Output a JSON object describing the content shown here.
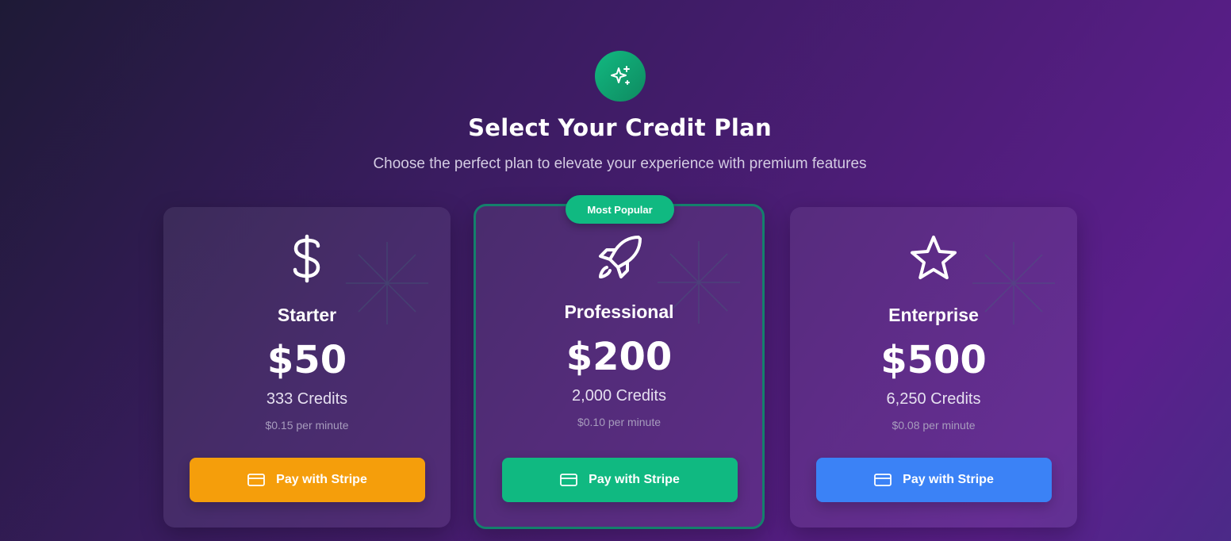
{
  "header": {
    "logo_icon": "sparkles-icon",
    "title": "Select Your Credit Plan",
    "subtitle": "Choose the perfect plan to elevate your experience with premium features"
  },
  "plans": [
    {
      "icon": "dollar-icon",
      "name": "Starter",
      "price": "$50",
      "credits": "333 Credits",
      "rate": "$0.15 per minute",
      "button_label": "Pay with Stripe",
      "button_color": "#f59e0b"
    },
    {
      "icon": "rocket-icon",
      "badge": "Most Popular",
      "name": "Professional",
      "price": "$200",
      "credits": "2,000 Credits",
      "rate": "$0.10 per minute",
      "button_label": "Pay with Stripe",
      "button_color": "#10b981",
      "highlight_color": "#14806c"
    },
    {
      "icon": "star-icon",
      "name": "Enterprise",
      "price": "$500",
      "credits": "6,250 Credits",
      "rate": "$0.08 per minute",
      "button_label": "Pay with Stripe",
      "button_color": "#3b82f6"
    }
  ],
  "colors": {
    "accent_green": "#10b981",
    "background_start": "#1e1a36",
    "background_end": "#5b1f8c"
  }
}
